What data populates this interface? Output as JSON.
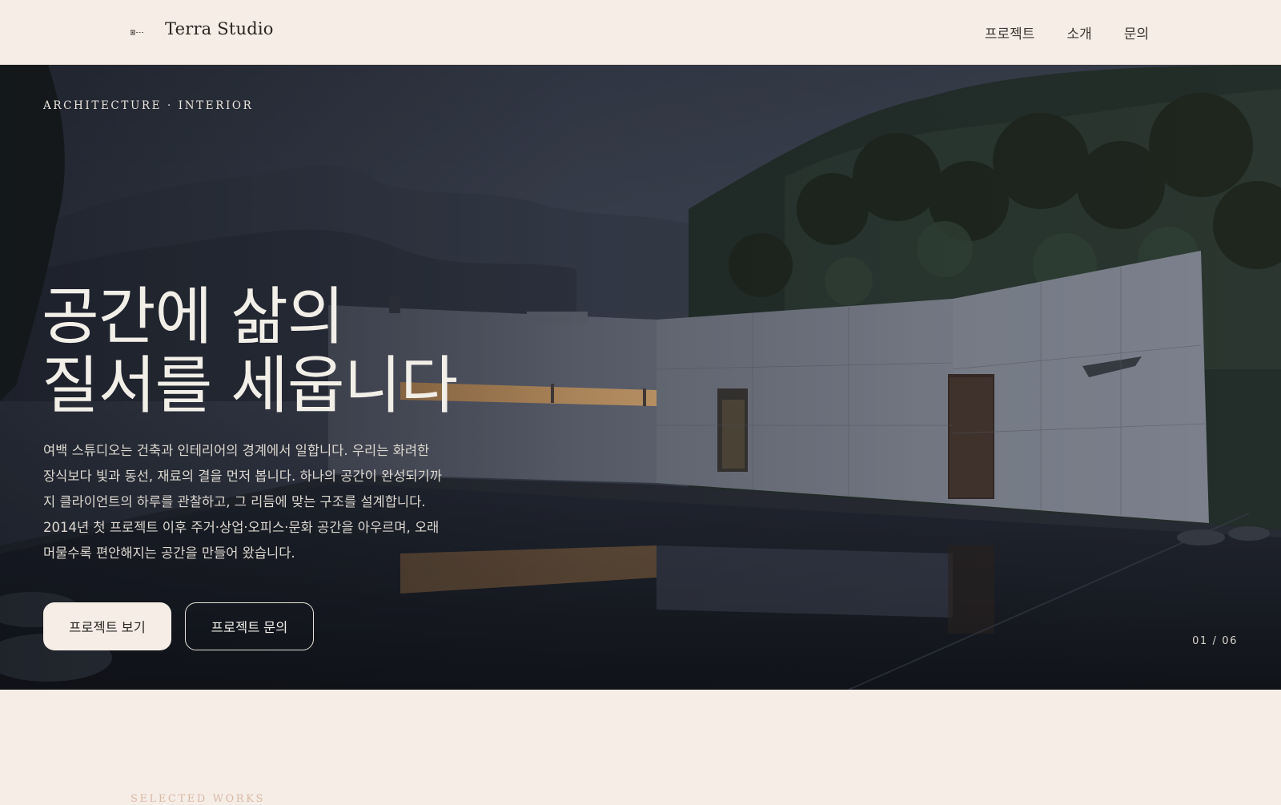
{
  "header": {
    "brand": "Terra Studio",
    "logo_icon": "logo-mark-icon",
    "nav": [
      {
        "label": "프로젝트"
      },
      {
        "label": "소개"
      },
      {
        "label": "문의"
      }
    ]
  },
  "hero": {
    "eyebrow": "ARCHITECTURE · INTERIOR",
    "headline_line1": "공간에 삶의",
    "headline_line2": "질서를 세웁니다",
    "description": "여백 스튜디오는 건축과 인테리어의 경계에서 일합니다. 우리는 화려한 장식보다 빛과 동선, 재료의 결을 먼저 봅니다. 하나의 공간이 완성되기까지 클라이언트의 하루를 관찰하고, 그 리듬에 맞는 구조를 설계합니다. 2014년 첫 프로젝트 이후 주거·상업·오피스·문화 공간을 아우르며, 오래 머물수록 편안해지는 공간을 만들어 왔습니다.",
    "primary_button": "프로젝트 보기",
    "secondary_button": "프로젝트 문의",
    "slide_counter": "01 / 06",
    "slide_current": 1,
    "slide_total": 6
  },
  "selected_works": {
    "label": "SELECTED WORKS"
  },
  "colors": {
    "background": "#f5ede6",
    "text_dark": "#2b2622",
    "hero_text": "#f2efe8",
    "accent_label": "#d9b9a6"
  }
}
